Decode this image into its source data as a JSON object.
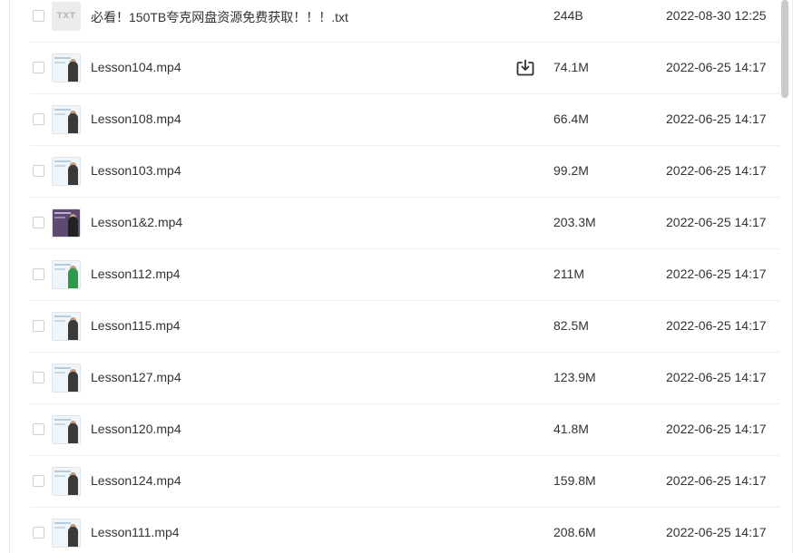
{
  "files": [
    {
      "name": "必看！150TB夸克网盘资源免费获取！！！.txt",
      "size": "244B",
      "date": "2022-08-30 12:25",
      "type": "txt",
      "thumb_label": "TXT",
      "thumb_icon": "txt-file-icon"
    },
    {
      "name": "Lesson104.mp4",
      "size": "74.1M",
      "date": "2022-06-25 14:17",
      "type": "video",
      "thumb_icon": "video-thumbnail",
      "show_download": true
    },
    {
      "name": "Lesson108.mp4",
      "size": "66.4M",
      "date": "2022-06-25 14:17",
      "type": "video",
      "thumb_icon": "video-thumbnail"
    },
    {
      "name": "Lesson103.mp4",
      "size": "99.2M",
      "date": "2022-06-25 14:17",
      "type": "video",
      "thumb_icon": "video-thumbnail"
    },
    {
      "name": "Lesson1&2.mp4",
      "size": "203.3M",
      "date": "2022-06-25 14:17",
      "type": "video",
      "thumb_icon": "video-thumbnail"
    },
    {
      "name": "Lesson112.mp4",
      "size": "211M",
      "date": "2022-06-25 14:17",
      "type": "video",
      "thumb_icon": "video-thumbnail"
    },
    {
      "name": "Lesson115.mp4",
      "size": "82.5M",
      "date": "2022-06-25 14:17",
      "type": "video",
      "thumb_icon": "video-thumbnail"
    },
    {
      "name": "Lesson127.mp4",
      "size": "123.9M",
      "date": "2022-06-25 14:17",
      "type": "video",
      "thumb_icon": "video-thumbnail"
    },
    {
      "name": "Lesson120.mp4",
      "size": "41.8M",
      "date": "2022-06-25 14:17",
      "type": "video",
      "thumb_icon": "video-thumbnail"
    },
    {
      "name": "Lesson124.mp4",
      "size": "159.8M",
      "date": "2022-06-25 14:17",
      "type": "video",
      "thumb_icon": "video-thumbnail"
    },
    {
      "name": "Lesson111.mp4",
      "size": "208.6M",
      "date": "2022-06-25 14:17",
      "type": "video",
      "thumb_icon": "video-thumbnail"
    }
  ],
  "download_icon": "download-icon",
  "colors": {
    "text": "#333333",
    "divider": "#eeeeee",
    "scrollbar_thumb": "#c9c9c9"
  }
}
